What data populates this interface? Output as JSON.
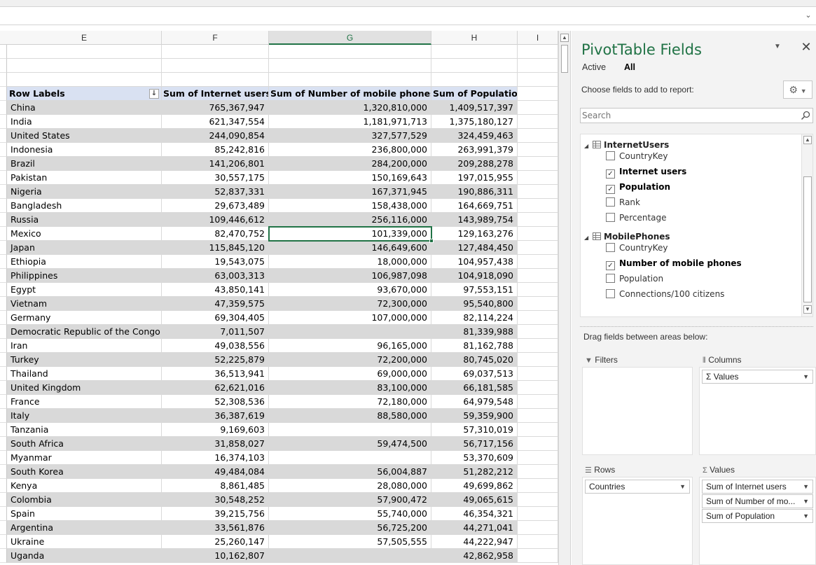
{
  "formula_bar": {
    "expand_icon": "chevron-down-icon"
  },
  "columns": [
    {
      "label": "E",
      "selected": false
    },
    {
      "label": "F",
      "selected": false
    },
    {
      "label": "G",
      "selected": true
    },
    {
      "label": "H",
      "selected": false
    },
    {
      "label": "I",
      "selected": false
    }
  ],
  "pivot": {
    "headers": [
      "Row Labels",
      "Sum of Internet users",
      "Sum of Number of mobile phones",
      "Sum of Population"
    ],
    "rows": [
      [
        "China",
        "765,367,947",
        "1,320,810,000",
        "1,409,517,397"
      ],
      [
        "India",
        "621,347,554",
        "1,181,971,713",
        "1,375,180,127"
      ],
      [
        "United States",
        "244,090,854",
        "327,577,529",
        "324,459,463"
      ],
      [
        "Indonesia",
        "85,242,816",
        "236,800,000",
        "263,991,379"
      ],
      [
        "Brazil",
        "141,206,801",
        "284,200,000",
        "209,288,278"
      ],
      [
        "Pakistan",
        "30,557,175",
        "150,169,643",
        "197,015,955"
      ],
      [
        "Nigeria",
        "52,837,331",
        "167,371,945",
        "190,886,311"
      ],
      [
        "Bangladesh",
        "29,673,489",
        "158,438,000",
        "164,669,751"
      ],
      [
        "Russia",
        "109,446,612",
        "256,116,000",
        "143,989,754"
      ],
      [
        "Mexico",
        "82,470,752",
        "101,339,000",
        "129,163,276"
      ],
      [
        "Japan",
        "115,845,120",
        "146,649,600",
        "127,484,450"
      ],
      [
        "Ethiopia",
        "19,543,075",
        "18,000,000",
        "104,957,438"
      ],
      [
        "Philippines",
        "63,003,313",
        "106,987,098",
        "104,918,090"
      ],
      [
        "Egypt",
        "43,850,141",
        "93,670,000",
        "97,553,151"
      ],
      [
        "Vietnam",
        "47,359,575",
        "72,300,000",
        "95,540,800"
      ],
      [
        "Germany",
        "69,304,405",
        "107,000,000",
        "82,114,224"
      ],
      [
        "Democratic Republic of the Congo",
        "7,011,507",
        "",
        "81,339,988"
      ],
      [
        "Iran",
        "49,038,556",
        "96,165,000",
        "81,162,788"
      ],
      [
        "Turkey",
        "52,225,879",
        "72,200,000",
        "80,745,020"
      ],
      [
        "Thailand",
        "36,513,941",
        "69,000,000",
        "69,037,513"
      ],
      [
        "United Kingdom",
        "62,621,016",
        "83,100,000",
        "66,181,585"
      ],
      [
        "France",
        "52,308,536",
        "72,180,000",
        "64,979,548"
      ],
      [
        "Italy",
        "36,387,619",
        "88,580,000",
        "59,359,900"
      ],
      [
        "Tanzania",
        "9,169,603",
        "",
        "57,310,019"
      ],
      [
        "South Africa",
        "31,858,027",
        "59,474,500",
        "56,717,156"
      ],
      [
        "Myanmar",
        "16,374,103",
        "",
        "53,370,609"
      ],
      [
        "South Korea",
        "49,484,084",
        "56,004,887",
        "51,282,212"
      ],
      [
        "Kenya",
        "8,861,485",
        "28,080,000",
        "49,699,862"
      ],
      [
        "Colombia",
        "30,548,252",
        "57,900,472",
        "49,065,615"
      ],
      [
        "Spain",
        "39,215,756",
        "55,740,000",
        "46,354,321"
      ],
      [
        "Argentina",
        "33,561,876",
        "56,725,200",
        "44,271,041"
      ],
      [
        "Ukraine",
        "25,260,147",
        "57,505,555",
        "44,222,947"
      ],
      [
        "Uganda",
        "10,162,807",
        "",
        "42,862,958"
      ]
    ]
  },
  "pane": {
    "title": "PivotTable Fields",
    "tab_active": "Active",
    "tab_all": "All",
    "choose_label": "Choose fields to add to report:",
    "search_placeholder": "Search",
    "tables": [
      {
        "name": "InternetUsers",
        "fields": [
          {
            "label": "CountryKey",
            "checked": false
          },
          {
            "label": "Internet users",
            "checked": true
          },
          {
            "label": "Population",
            "checked": true
          },
          {
            "label": "Rank",
            "checked": false
          },
          {
            "label": "Percentage",
            "checked": false
          }
        ]
      },
      {
        "name": "MobilePhones",
        "fields": [
          {
            "label": "CountryKey",
            "checked": false
          },
          {
            "label": "Number of mobile phones",
            "checked": true
          },
          {
            "label": "Population",
            "checked": false
          },
          {
            "label": "Connections/100 citizens",
            "checked": false
          }
        ]
      }
    ],
    "drag_label": "Drag fields between areas below:",
    "areas": {
      "filters": {
        "title": "Filters",
        "items": []
      },
      "columns": {
        "title": "Columns",
        "items": [
          "Σ Values"
        ]
      },
      "rows": {
        "title": "Rows",
        "items": [
          "Countries"
        ]
      },
      "values": {
        "title": "Values",
        "items": [
          "Sum of Internet users",
          "Sum of Number of mo...",
          "Sum of Population"
        ]
      }
    }
  }
}
